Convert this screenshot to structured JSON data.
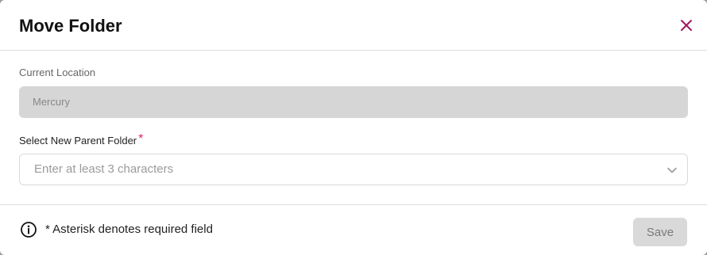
{
  "dialog": {
    "title": "Move Folder",
    "close_icon": "close-icon",
    "accent_color": "#a3195b"
  },
  "current_location": {
    "label": "Current Location",
    "value": "Mercury"
  },
  "new_parent": {
    "label": "Select New Parent Folder",
    "required_marker": "*",
    "placeholder": "Enter at least 3 characters",
    "dropdown_icon": "chevron-down-icon"
  },
  "footer": {
    "info_icon": "info-icon",
    "note": "* Asterisk denotes required field",
    "save_label": "Save"
  }
}
